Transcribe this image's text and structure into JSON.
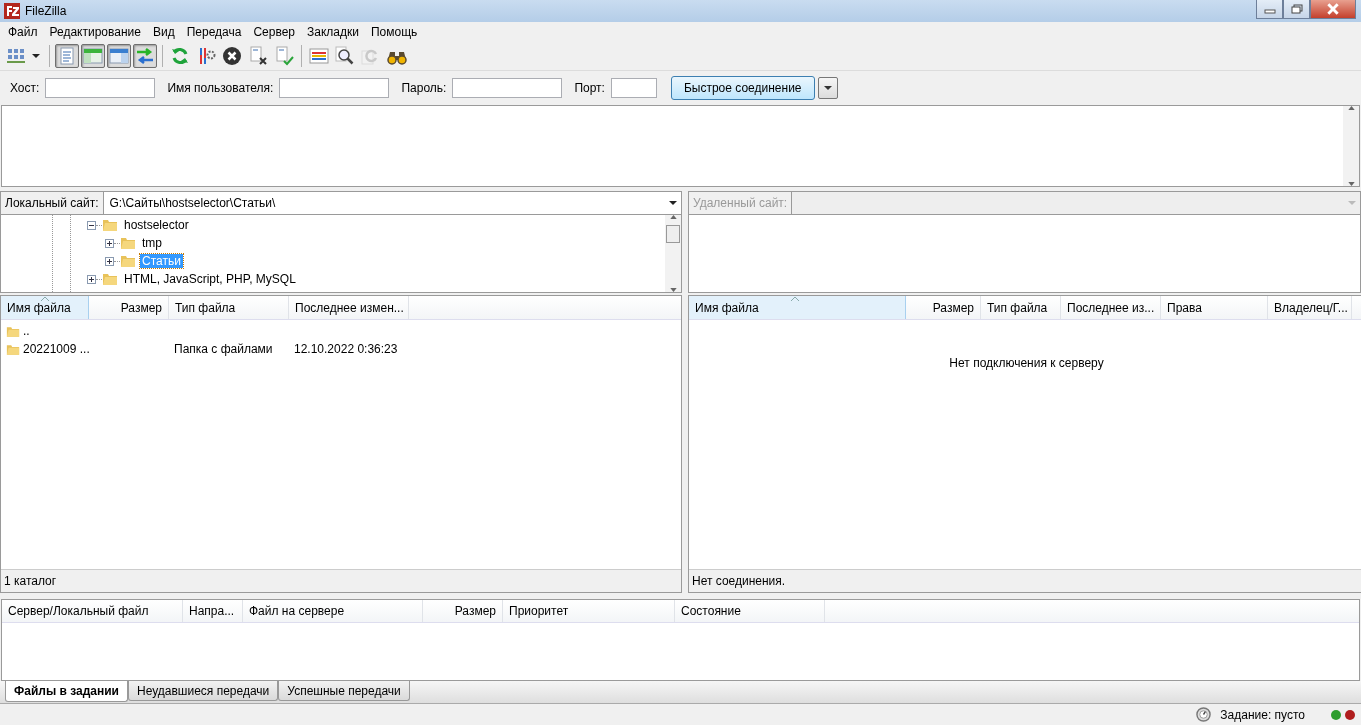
{
  "window": {
    "title": "FileZilla"
  },
  "menu": [
    "Файл",
    "Редактирование",
    "Вид",
    "Передача",
    "Сервер",
    "Закладки",
    "Помощь"
  ],
  "toolbar": {
    "toggles": [
      {
        "pressed": true
      },
      {
        "pressed": true
      },
      {
        "pressed": true
      },
      {
        "pressed": true
      }
    ],
    "buttons": [
      {
        "disabled": false
      },
      {
        "disabled": false
      },
      {
        "disabled": false
      },
      {
        "disabled": false
      },
      {
        "disabled": false
      },
      {
        "disabled": false
      },
      {
        "disabled": false
      },
      {
        "disabled": true
      },
      {
        "disabled": false
      }
    ]
  },
  "quickconnect": {
    "fields": [
      {
        "label": "Хост:"
      },
      {
        "label": "Имя пользователя:"
      },
      {
        "label": "Пароль:"
      },
      {
        "label": "Порт:"
      }
    ],
    "button": "Быстрое соединение"
  },
  "local": {
    "site_label": "Локальный сайт:",
    "path": "G:\\Сайты\\hostselector\\Статьи\\",
    "tree": [
      {
        "label": "hostselector",
        "expanded": true,
        "selected": false,
        "has_children": true,
        "children": [
          {
            "label": "tmp",
            "expanded": false,
            "selected": false,
            "has_children": true
          },
          {
            "label": "Статьи",
            "expanded": false,
            "selected": true,
            "has_children": true
          }
        ]
      },
      {
        "label": "HTML, JavaScript, PHP, MySQL",
        "expanded": false,
        "selected": false,
        "has_children": true
      }
    ],
    "columns": [
      {
        "label": "Имя файла",
        "sorted": true
      },
      {
        "label": "Размер",
        "sorted": false
      },
      {
        "label": "Тип файла",
        "sorted": false
      },
      {
        "label": "Последнее измен...",
        "sorted": false
      }
    ],
    "rows": [
      {
        "name": ".."
      },
      {
        "name": "20221009 ...",
        "type": "Папка с файлами",
        "modified": "12.10.2022 0:36:23"
      }
    ],
    "status": "1 каталог"
  },
  "remote": {
    "site_label": "Удаленный сайт:",
    "disabled": true,
    "columns": [
      {
        "label": "Имя файла",
        "sorted": true
      },
      {
        "label": "Размер",
        "sorted": false
      },
      {
        "label": "Тип файла",
        "sorted": false
      },
      {
        "label": "Последнее из...",
        "sorted": false
      },
      {
        "label": "Права",
        "sorted": false
      },
      {
        "label": "Владелец/Г...",
        "sorted": false
      }
    ],
    "message": "Нет подключения к серверу",
    "status": "Нет соединения."
  },
  "queue": {
    "columns": [
      "Сервер/Локальный файл",
      "Напра...",
      "Файл на сервере",
      "Размер",
      "Приоритет",
      "Состояние"
    ],
    "tabs": [
      {
        "label": "Файлы в задании",
        "selected": true
      },
      {
        "label": "Неудавшиеся передачи",
        "selected": false
      },
      {
        "label": "Успешные передачи",
        "selected": false
      }
    ]
  },
  "status_bar": {
    "queue": "Задание: пусто",
    "lights": [
      {
        "color": "#2e9e2e"
      },
      {
        "color": "#b01e1e"
      }
    ]
  }
}
